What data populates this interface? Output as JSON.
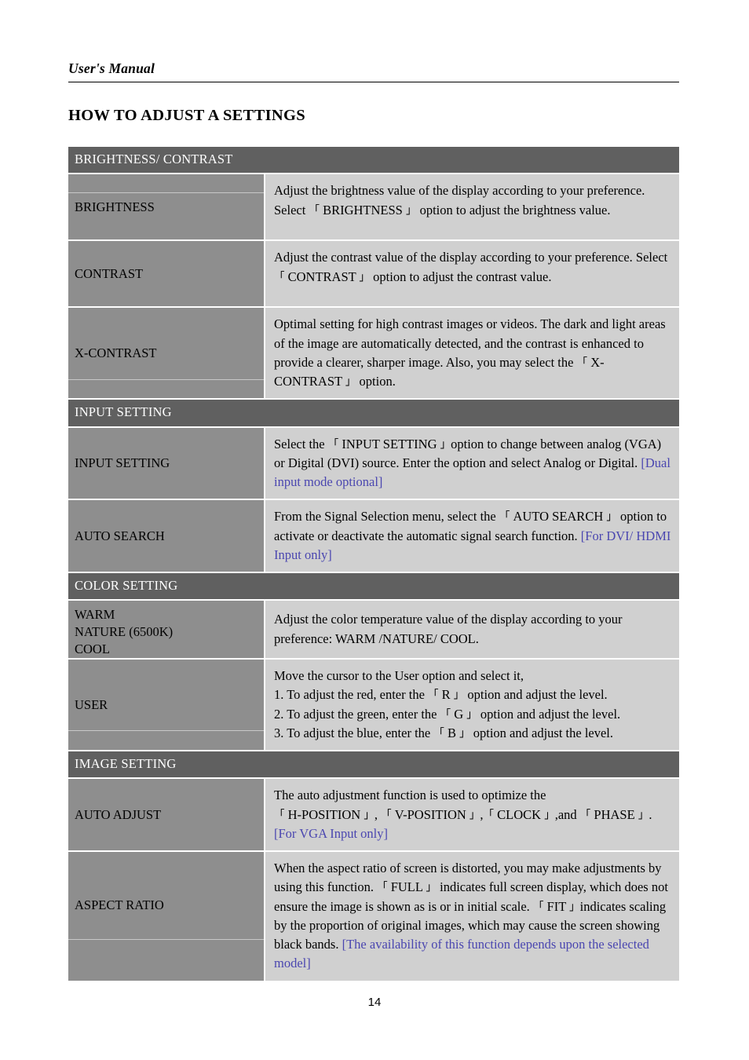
{
  "document": {
    "running_header": "User's Manual",
    "page_title": "HOW TO ADJUST A SETTINGS",
    "page_number": "14"
  },
  "colors": {
    "section_band": "#606060",
    "label_cell": "#8e8e8e",
    "desc_cell": "#d0d0d0",
    "note_blue": "#4a46b0",
    "page_background": "#ffffff"
  },
  "sections": [
    {
      "heading": "BRIGHTNESS/ CONTRAST",
      "rows": [
        {
          "label": "BRIGHTNESS",
          "desc_pre": "Adjust the brightness value of the display according to your preference. Select ",
          "bracket_open": "「",
          "desc_mid": " BRIGHTNESS ",
          "bracket_close": "」",
          "desc_post": " option to adjust the brightness value.",
          "note": ""
        },
        {
          "label": "CONTRAST",
          "desc_pre": "Adjust the contrast value of the display according to your preference. Select ",
          "bracket_open": "「",
          "desc_mid": " CONTRAST ",
          "bracket_close": "」",
          "desc_post": " option to adjust the contrast value.",
          "note": ""
        },
        {
          "label": "X-CONTRAST",
          "desc_pre": "Optimal setting for high contrast images or videos. The dark and light areas of the image are automatically detected, and the contrast is enhanced to provide a clearer, sharper image. Also, you may select the ",
          "bracket_open": "「",
          "desc_mid": " X-CONTRAST ",
          "bracket_close": "」",
          "desc_post": " option.",
          "note": ""
        }
      ]
    },
    {
      "heading": "INPUT SETTING",
      "rows": [
        {
          "label": "INPUT SETTING",
          "desc_pre": "Select the ",
          "bracket_open": "「",
          "desc_mid": " INPUT SETTING ",
          "bracket_close": "」",
          "desc_post": "option to change between analog (VGA) or Digital (DVI) source. Enter the option and select Analog or Digital. ",
          "note": "[Dual input mode optional]"
        },
        {
          "label": "AUTO SEARCH",
          "desc_pre": "From the Signal Selection menu, select the  ",
          "bracket_open": "「",
          "desc_mid": " AUTO SEARCH ",
          "bracket_close": "」",
          "desc_post": " option to activate or deactivate the automatic signal search function. ",
          "note": "[For DVI/ HDMI Input only]"
        }
      ]
    },
    {
      "heading": "COLOR SETTING",
      "rows": [
        {
          "label_lines": [
            "WARM",
            "NATURE (6500K)",
            "COOL"
          ],
          "desc_plain": "Adjust the color temperature value of the display according to your preference: WARM /NATURE/ COOL.",
          "note": ""
        },
        {
          "label": "USER",
          "user_lines": {
            "line0": "Move the cursor to the User option and select it,",
            "line1_pre": "1. To adjust the red, enter the ",
            "line1_key": " R ",
            "line1_post": " option and adjust the level.",
            "line2_pre": "2. To adjust the green, enter the ",
            "line2_key": " G ",
            "line2_post": " option and adjust the level.",
            "line3_pre": "3. To adjust the blue, enter the ",
            "line3_key": " B ",
            "line3_post": " option and adjust the level."
          }
        }
      ]
    },
    {
      "heading": "IMAGE SETTING",
      "rows": [
        {
          "label": "AUTO ADJUST",
          "auto_adjust": {
            "line0": "The auto adjustment function is used to optimize the",
            "k1": " H-POSITION ",
            "sep1": ", ",
            "k2": " V-POSITION ",
            "sep2": ",",
            "k3": " CLOCK ",
            "sep3": ",and ",
            "k4": " PHASE ",
            "tail": "."
          },
          "note": "[For VGA Input only]"
        },
        {
          "label": "ASPECT RATIO",
          "aspect": {
            "pre": "When the aspect ratio of screen is distorted, you may make adjustments by using this function. ",
            "k1": " FULL ",
            "mid": " indicates full screen display, which does not ensure the image is shown as is or in initial scale. ",
            "k2": " FIT ",
            "post": "indicates scaling by the proportion of original images, which may cause the screen showing black bands. "
          },
          "note": "[The availability of this function depends upon the selected model]"
        }
      ]
    }
  ],
  "glyphs": {
    "bracket_open": "「",
    "bracket_close": "」"
  }
}
